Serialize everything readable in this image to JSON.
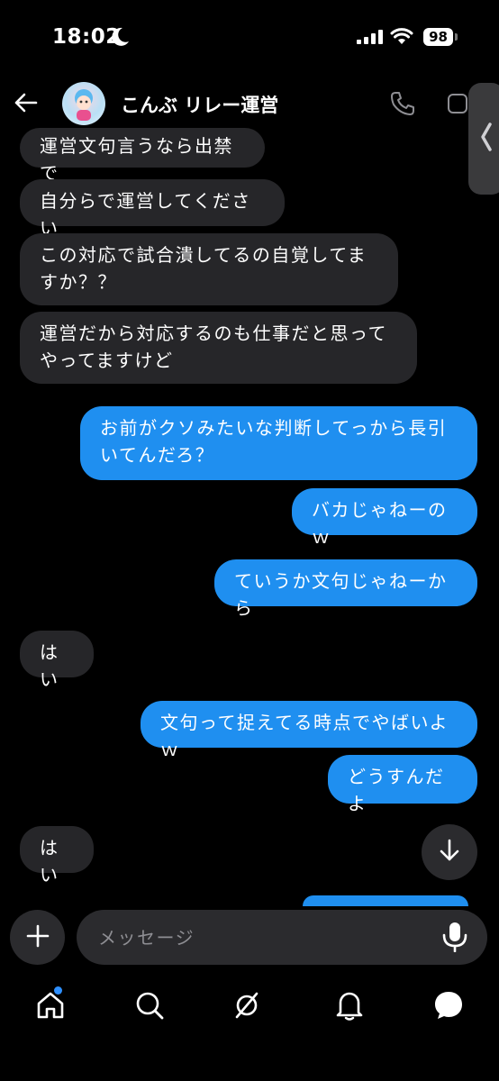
{
  "status_bar": {
    "time": "18:02",
    "battery": "98",
    "icons": [
      "moon-icon",
      "signal-icon",
      "wifi-icon",
      "battery-icon"
    ]
  },
  "header": {
    "title": "こんぶ リレー運営",
    "icons": [
      "back-arrow-icon",
      "avatar",
      "phone-icon",
      "video-icon",
      "chevron-left-icon"
    ]
  },
  "messages": [
    {
      "side": "in",
      "text": "運営文句言うなら出禁で"
    },
    {
      "side": "in",
      "text": "自分らで運営してください"
    },
    {
      "side": "in",
      "text": "この対応で試合潰してるの自覚してますか？？"
    },
    {
      "side": "in",
      "text": "運営だから対応するのも仕事だと思ってやってますけど"
    },
    {
      "side": "out",
      "text": "お前がクソみたいな判断してっから長引いてんだろ？"
    },
    {
      "side": "out",
      "text": "バカじゃねーのｗ"
    },
    {
      "side": "out",
      "text": "ていうか文句じゃねーから"
    },
    {
      "side": "in",
      "text": "はい"
    },
    {
      "side": "out",
      "text": "文句って捉えてる時点でやばいよｗ"
    },
    {
      "side": "out",
      "text": "どうすんだよ"
    },
    {
      "side": "in",
      "text": "はい"
    }
  ],
  "composer": {
    "placeholder": "メッセージ",
    "value": ""
  },
  "tab_bar": {
    "items": [
      "home-icon",
      "search-icon",
      "explore-icon",
      "notifications-icon",
      "messages-icon"
    ],
    "active": "home"
  },
  "colors": {
    "background": "#000000",
    "incoming_bubble": "#262629",
    "outgoing_bubble": "#1f8ff0",
    "notification_dot": "#2e90ff"
  }
}
